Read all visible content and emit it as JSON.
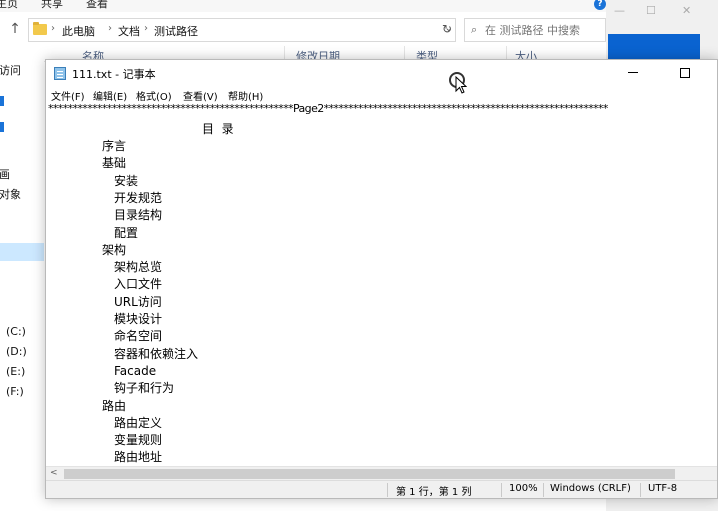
{
  "explorer": {
    "ribbon_tabs": [
      "主页",
      "共享",
      "查看"
    ],
    "breadcrumbs": [
      "此电脑",
      "文档",
      "测试路径"
    ],
    "search_placeholder": "在 测试路径 中搜索",
    "columns": [
      "名称",
      "修改日期",
      "类型",
      "大小"
    ],
    "nav_items": [
      "访问",
      "画",
      "对象",
      "(C:)",
      "(D:)",
      "(E:)",
      "(F:)"
    ]
  },
  "notepad": {
    "title": "111.txt - 记事本",
    "menu": [
      "文件(F)",
      "编辑(E)",
      "格式(O)",
      "查看(V)",
      "帮助(H)"
    ],
    "content": {
      "separator": "**************************************************Page2**********************************************************",
      "toc_title": "目  录",
      "lines": [
        {
          "text": "序言",
          "indent": 1
        },
        {
          "text": "基础",
          "indent": 1
        },
        {
          "text": "安装",
          "indent": 2
        },
        {
          "text": "开发规范",
          "indent": 2
        },
        {
          "text": "目录结构",
          "indent": 2
        },
        {
          "text": "配置",
          "indent": 2
        },
        {
          "text": "架构",
          "indent": 1
        },
        {
          "text": "架构总览",
          "indent": 2
        },
        {
          "text": "入口文件",
          "indent": 2
        },
        {
          "text": "URL访问",
          "indent": 2
        },
        {
          "text": "模块设计",
          "indent": 2
        },
        {
          "text": "命名空间",
          "indent": 2
        },
        {
          "text": "容器和依赖注入",
          "indent": 2
        },
        {
          "text": "Facade",
          "indent": 2
        },
        {
          "text": "钩子和行为",
          "indent": 2
        },
        {
          "text": "路由",
          "indent": 1
        },
        {
          "text": "路由定义",
          "indent": 2
        },
        {
          "text": "变量规则",
          "indent": 2
        },
        {
          "text": "路由地址",
          "indent": 2
        }
      ]
    },
    "status": {
      "position": "第 1 行，第 1 列",
      "zoom": "100%",
      "line_ending": "Windows (CRLF)",
      "encoding": "UTF-8"
    }
  }
}
